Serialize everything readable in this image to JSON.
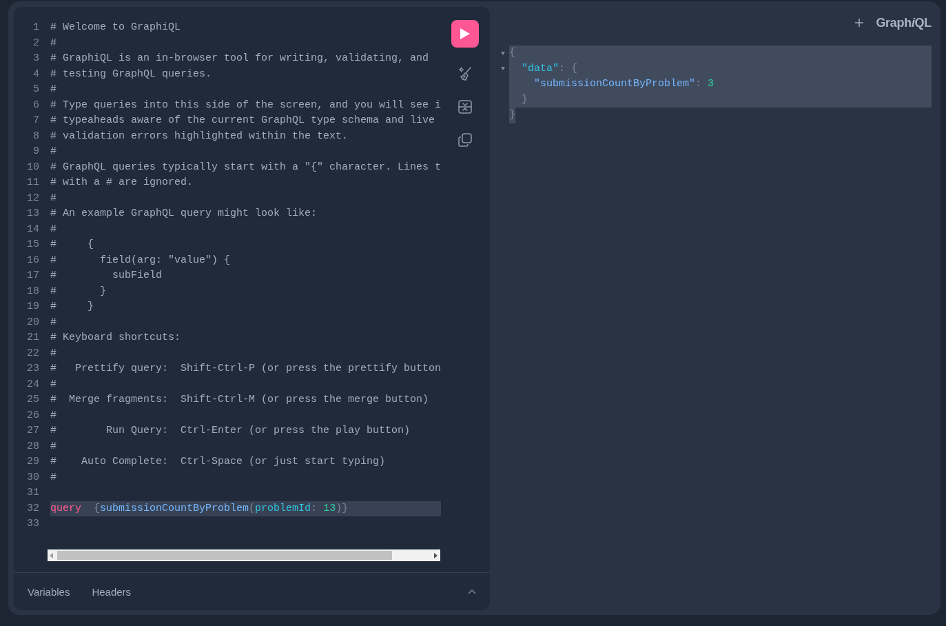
{
  "editor": {
    "lines": [
      {
        "number": "1",
        "tokens": [
          {
            "kind": "comment",
            "text": "# Welcome to GraphiQL"
          }
        ]
      },
      {
        "number": "2",
        "tokens": [
          {
            "kind": "comment",
            "text": "#"
          }
        ]
      },
      {
        "number": "3",
        "tokens": [
          {
            "kind": "comment",
            "text": "# GraphiQL is an in-browser tool for writing, validating, and"
          }
        ]
      },
      {
        "number": "4",
        "tokens": [
          {
            "kind": "comment",
            "text": "# testing GraphQL queries."
          }
        ]
      },
      {
        "number": "5",
        "tokens": [
          {
            "kind": "comment",
            "text": "#"
          }
        ]
      },
      {
        "number": "6",
        "tokens": [
          {
            "kind": "comment",
            "text": "# Type queries into this side of the screen, and you will see i"
          }
        ]
      },
      {
        "number": "7",
        "tokens": [
          {
            "kind": "comment",
            "text": "# typeaheads aware of the current GraphQL type schema and live"
          }
        ]
      },
      {
        "number": "8",
        "tokens": [
          {
            "kind": "comment",
            "text": "# validation errors highlighted within the text."
          }
        ]
      },
      {
        "number": "9",
        "tokens": [
          {
            "kind": "comment",
            "text": "#"
          }
        ]
      },
      {
        "number": "10",
        "tokens": [
          {
            "kind": "comment",
            "text": "# GraphQL queries typically start with a \"{\" character. Lines t"
          }
        ]
      },
      {
        "number": "11",
        "tokens": [
          {
            "kind": "comment",
            "text": "# with a # are ignored."
          }
        ]
      },
      {
        "number": "12",
        "tokens": [
          {
            "kind": "comment",
            "text": "#"
          }
        ]
      },
      {
        "number": "13",
        "tokens": [
          {
            "kind": "comment",
            "text": "# An example GraphQL query might look like:"
          }
        ]
      },
      {
        "number": "14",
        "tokens": [
          {
            "kind": "comment",
            "text": "#"
          }
        ]
      },
      {
        "number": "15",
        "tokens": [
          {
            "kind": "comment",
            "text": "#     {"
          }
        ]
      },
      {
        "number": "16",
        "tokens": [
          {
            "kind": "comment",
            "text": "#       field(arg: \"value\") {"
          }
        ]
      },
      {
        "number": "17",
        "tokens": [
          {
            "kind": "comment",
            "text": "#         subField"
          }
        ]
      },
      {
        "number": "18",
        "tokens": [
          {
            "kind": "comment",
            "text": "#       }"
          }
        ]
      },
      {
        "number": "19",
        "tokens": [
          {
            "kind": "comment",
            "text": "#     }"
          }
        ]
      },
      {
        "number": "20",
        "tokens": [
          {
            "kind": "comment",
            "text": "#"
          }
        ]
      },
      {
        "number": "21",
        "tokens": [
          {
            "kind": "comment",
            "text": "# Keyboard shortcuts:"
          }
        ]
      },
      {
        "number": "22",
        "tokens": [
          {
            "kind": "comment",
            "text": "#"
          }
        ]
      },
      {
        "number": "23",
        "tokens": [
          {
            "kind": "comment",
            "text": "#   Prettify query:  Shift-Ctrl-P (or press the prettify button"
          }
        ]
      },
      {
        "number": "24",
        "tokens": [
          {
            "kind": "comment",
            "text": "#"
          }
        ]
      },
      {
        "number": "25",
        "tokens": [
          {
            "kind": "comment",
            "text": "#  Merge fragments:  Shift-Ctrl-M (or press the merge button)"
          }
        ]
      },
      {
        "number": "26",
        "tokens": [
          {
            "kind": "comment",
            "text": "#"
          }
        ]
      },
      {
        "number": "27",
        "tokens": [
          {
            "kind": "comment",
            "text": "#        Run Query:  Ctrl-Enter (or press the play button)"
          }
        ]
      },
      {
        "number": "28",
        "tokens": [
          {
            "kind": "comment",
            "text": "#"
          }
        ]
      },
      {
        "number": "29",
        "tokens": [
          {
            "kind": "comment",
            "text": "#    Auto Complete:  Ctrl-Space (or just start typing)"
          }
        ]
      },
      {
        "number": "30",
        "tokens": [
          {
            "kind": "comment",
            "text": "#"
          }
        ]
      },
      {
        "number": "31"
      },
      {
        "number": "32",
        "active": true,
        "tokens": [
          {
            "kind": "keyword",
            "text": "query"
          },
          {
            "kind": "punctuation",
            "text": "  {"
          },
          {
            "kind": "field",
            "text": "submissionCountByProblem"
          },
          {
            "kind": "punctuation",
            "text": "("
          },
          {
            "kind": "argument",
            "text": "problemId"
          },
          {
            "kind": "punctuation",
            "text": ": "
          },
          {
            "kind": "number",
            "text": "13"
          },
          {
            "kind": "punctuation",
            "text": ")}"
          }
        ]
      },
      {
        "number": "33"
      }
    ]
  },
  "tabs": [
    {
      "label": "Variables"
    },
    {
      "label": "Headers"
    }
  ],
  "logo": [
    {
      "text": "Graph",
      "italic": false
    },
    {
      "text": "i",
      "italic": true
    },
    {
      "text": "QL",
      "italic": false
    }
  ],
  "result": {
    "lines": [
      {
        "foldable": true,
        "selected": true,
        "tokens": [
          {
            "kind": "punctuation",
            "text": "{"
          }
        ]
      },
      {
        "foldable": true,
        "selected": true,
        "tokens": [
          {
            "kind": "key",
            "text": "  \"data\""
          },
          {
            "kind": "punctuation",
            "text": ": {"
          }
        ]
      },
      {
        "foldable": false,
        "selected": true,
        "tokens": [
          {
            "kind": "property",
            "text": "    \"submissionCountByProblem\""
          },
          {
            "kind": "punctuation",
            "text": ": "
          },
          {
            "kind": "number",
            "text": "3"
          }
        ]
      },
      {
        "foldable": false,
        "selected": true,
        "tokens": [
          {
            "kind": "punctuation",
            "text": "  }"
          }
        ]
      },
      {
        "foldable": false,
        "selected": true,
        "tokens": [
          {
            "kind": "punctuation",
            "text": "}"
          }
        ]
      }
    ]
  }
}
